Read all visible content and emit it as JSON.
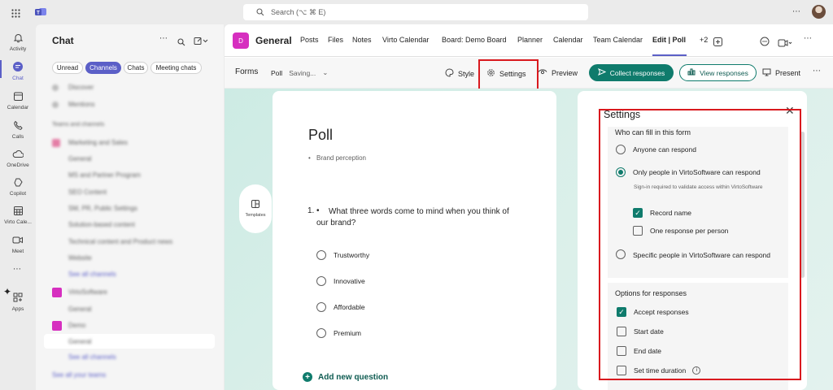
{
  "titlebar": {
    "search_placeholder": "Search (⌥ ⌘ E)"
  },
  "rail": [
    {
      "label": "Activity"
    },
    {
      "label": "Chat"
    },
    {
      "label": "Calendar"
    },
    {
      "label": "Calls"
    },
    {
      "label": "OneDrive"
    },
    {
      "label": "Copilot"
    },
    {
      "label": "Virto Cale..."
    },
    {
      "label": "Meet"
    },
    {
      "label": "Apps"
    }
  ],
  "chat_panel": {
    "title": "Chat",
    "filters": [
      "Unread",
      "Channels",
      "Chats",
      "Meeting chats"
    ],
    "items": [
      "Discover",
      "Mentions",
      "Teams and channels",
      "Marketing and Sales",
      "General",
      "MS and Partner Program",
      "SEO Content",
      "SM, PR, Public Settings",
      "Solution-based content",
      "Technical content and Product news",
      "Website",
      "See all channels",
      "VirtoSoftware",
      "General",
      "Demo",
      "General",
      "See all channels",
      "See all your teams"
    ]
  },
  "tabbar": {
    "avatar_letter": "D",
    "channel": "General",
    "tabs": [
      "Posts",
      "Files",
      "Notes",
      "Virto Calendar",
      "Board: Demo Board",
      "Planner",
      "Calendar",
      "Team Calendar",
      "Edit | Poll",
      "+2"
    ]
  },
  "toolbar": {
    "app": "Forms",
    "doc": "Poll",
    "status": "Saving...",
    "style": "Style",
    "settings": "Settings",
    "preview": "Preview",
    "collect": "Collect responses",
    "view": "View responses",
    "present": "Present"
  },
  "form": {
    "templates": "Templates",
    "title": "Poll",
    "subtitle": "Brand perception",
    "question_number": "1.",
    "question": "What three words come to mind when you think of our brand?",
    "options": [
      "Trustworthy",
      "Innovative",
      "Affordable",
      "Premium"
    ],
    "add_question": "Add new question"
  },
  "settings": {
    "title": "Settings",
    "who_heading": "Who can fill in this form",
    "anyone": "Anyone can respond",
    "only_org": "Only people in VirtoSoftware can respond",
    "signin_note": "Sign-in required to validate access within VirtoSoftware",
    "record_name": "Record name",
    "one_response": "One response per person",
    "specific": "Specific people in VirtoSoftware can respond",
    "options_heading": "Options for responses",
    "accept": "Accept responses",
    "start_date": "Start date",
    "end_date": "End date",
    "time_duration": "Set time duration"
  },
  "colors": {
    "accent": "#5b5fc7",
    "forms_green": "#0f7b6c",
    "highlight": "#d9191e",
    "channel_avatar": "#d62fbf"
  }
}
